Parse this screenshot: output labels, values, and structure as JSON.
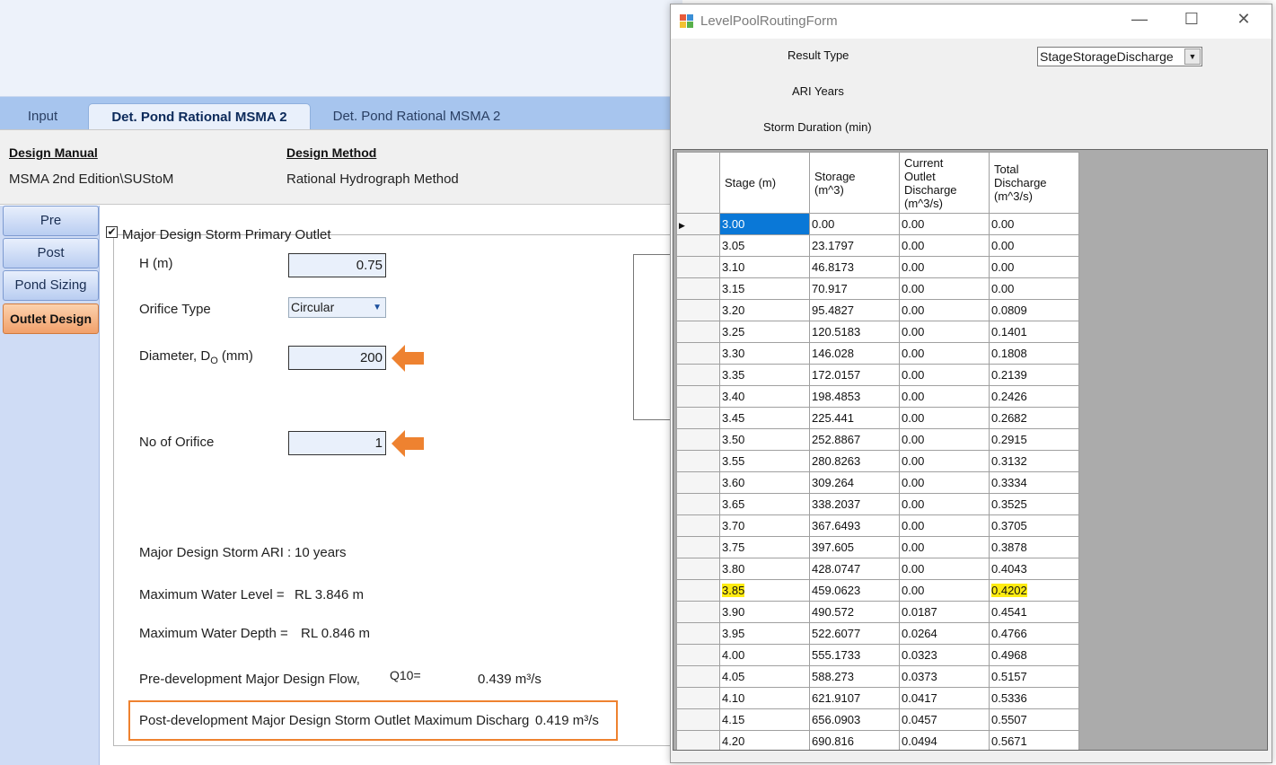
{
  "tabs": [
    {
      "label": "Input"
    },
    {
      "label": "Det. Pond Rational MSMA 2"
    },
    {
      "label": "Det. Pond Rational MSMA 2"
    }
  ],
  "info": {
    "design_manual_label": "Design Manual",
    "design_manual_value": "MSMA 2nd Edition\\SUStoM",
    "design_method_label": "Design Method",
    "design_method_value": "Rational Hydrograph Method"
  },
  "nav": [
    "Pre",
    "Post",
    "Pond Sizing",
    "Outlet Design"
  ],
  "outlet": {
    "group_title": "Major Design Storm Primary Outlet",
    "checkbox_mark": "✔",
    "h_label": "H (m)",
    "h_value": "0.75",
    "orifice_type_label": "Orifice Type",
    "orifice_type_value": "Circular",
    "diameter_label_main": "Diameter, D",
    "diameter_label_sub": "O",
    "diameter_label_unit": " (mm)",
    "diameter_value": "200",
    "no_orifice_label": "No of Orifice",
    "no_orifice_value": "1",
    "ari_label": "Major Design Storm ARI :",
    "ari_value": "10 years",
    "max_level_label": "Maximum Water Level =",
    "max_level_value": "RL 3.846 m",
    "max_depth_label": "Maximum Water Depth =",
    "max_depth_value": "RL 0.846 m",
    "pre_flow_label": "Pre-development Major Design Flow,",
    "pre_flow_q": "Q10=",
    "pre_flow_value": "0.439 m³/s",
    "post_label": "Post-development Major Design Storm Outlet Maximum Discharg",
    "post_value": "0.419 m³/s"
  },
  "dialog": {
    "title": "LevelPoolRoutingForm",
    "result_type_label": "Result Type",
    "result_type_value": "StageStorageDischarge",
    "ari_years_label": "ARI Years",
    "storm_duration_label": "Storm Duration (min)",
    "columns": [
      "Stage (m)",
      "Storage\n(m^3)",
      "Current\nOutlet\nDischarge\n(m^3/s)",
      "Total\nDischarge\n(m^3/s)"
    ],
    "rows": [
      [
        "3.00",
        "0.00",
        "0.00",
        "0.00"
      ],
      [
        "3.05",
        "23.1797",
        "0.00",
        "0.00"
      ],
      [
        "3.10",
        "46.8173",
        "0.00",
        "0.00"
      ],
      [
        "3.15",
        "70.917",
        "0.00",
        "0.00"
      ],
      [
        "3.20",
        "95.4827",
        "0.00",
        "0.0809"
      ],
      [
        "3.25",
        "120.5183",
        "0.00",
        "0.1401"
      ],
      [
        "3.30",
        "146.028",
        "0.00",
        "0.1808"
      ],
      [
        "3.35",
        "172.0157",
        "0.00",
        "0.2139"
      ],
      [
        "3.40",
        "198.4853",
        "0.00",
        "0.2426"
      ],
      [
        "3.45",
        "225.441",
        "0.00",
        "0.2682"
      ],
      [
        "3.50",
        "252.8867",
        "0.00",
        "0.2915"
      ],
      [
        "3.55",
        "280.8263",
        "0.00",
        "0.3132"
      ],
      [
        "3.60",
        "309.264",
        "0.00",
        "0.3334"
      ],
      [
        "3.65",
        "338.2037",
        "0.00",
        "0.3525"
      ],
      [
        "3.70",
        "367.6493",
        "0.00",
        "0.3705"
      ],
      [
        "3.75",
        "397.605",
        "0.00",
        "0.3878"
      ],
      [
        "3.80",
        "428.0747",
        "0.00",
        "0.4043"
      ],
      [
        "3.85",
        "459.0623",
        "0.00",
        "0.4202"
      ],
      [
        "3.90",
        "490.572",
        "0.0187",
        "0.4541"
      ],
      [
        "3.95",
        "522.6077",
        "0.0264",
        "0.4766"
      ],
      [
        "4.00",
        "555.1733",
        "0.0323",
        "0.4968"
      ],
      [
        "4.05",
        "588.273",
        "0.0373",
        "0.5157"
      ],
      [
        "4.10",
        "621.9107",
        "0.0417",
        "0.5336"
      ],
      [
        "4.15",
        "656.0903",
        "0.0457",
        "0.5507"
      ],
      [
        "4.20",
        "690.816",
        "0.0494",
        "0.5671"
      ]
    ],
    "highlight_row": "3.85",
    "selected_row": "3.00"
  },
  "colors": {
    "highlight": "#ffeb12",
    "selection": "#0a78d7",
    "annotation_orange": "#ee8230",
    "active_nav": "#f1a06a"
  }
}
